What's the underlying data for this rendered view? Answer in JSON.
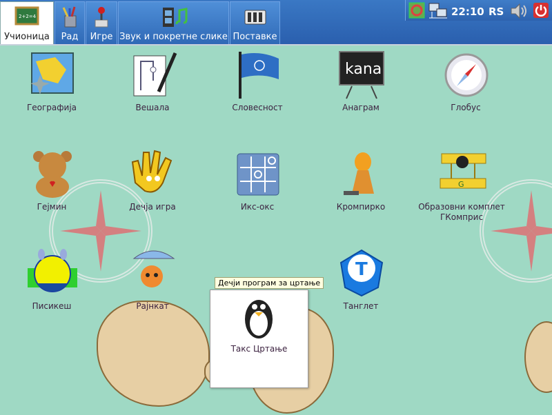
{
  "tabs": [
    {
      "label": "Учионица",
      "icon": "chalkboard-icon",
      "active": true
    },
    {
      "label": "Рад",
      "icon": "pencil-cup-icon",
      "active": false
    },
    {
      "label": "Игре",
      "icon": "joystick-icon",
      "active": false
    },
    {
      "label": "Звук и покретне слике",
      "icon": "film-music-icon",
      "active": false
    },
    {
      "label": "Поставке",
      "icon": "settings-panel-icon",
      "active": false
    }
  ],
  "tray": {
    "clock": "22:10",
    "language": "RS",
    "icons": [
      "safety-ring-icon",
      "network-icon",
      "volume-icon",
      "power-icon"
    ]
  },
  "apps": [
    {
      "label": "Географија",
      "icon": "map-icon"
    },
    {
      "label": "Вешала",
      "icon": "hangman-icon"
    },
    {
      "label": "Словесност",
      "icon": "flag-icon"
    },
    {
      "label": "Анаграм",
      "icon": "blackboard-icon",
      "board_text": "kana"
    },
    {
      "label": "Глобус",
      "icon": "compass-icon"
    },
    {
      "label": "Гејмин",
      "icon": "teddy-bear-icon"
    },
    {
      "label": "Дечја игра",
      "icon": "hand-icon"
    },
    {
      "label": "Икс-окс",
      "icon": "tic-tac-toe-icon"
    },
    {
      "label": "Кромпирко",
      "icon": "potato-icon"
    },
    {
      "label": "Образовни комплет ГКомприс",
      "icon": "airplane-penguin-icon"
    },
    {
      "label": "Писикеш",
      "icon": "pisikesh-icon"
    },
    {
      "label": "Рајнкат",
      "icon": "rain-cat-icon"
    },
    {
      "label": "Такс Цртање",
      "icon": "tux-paint-icon"
    },
    {
      "label": "Танглет",
      "icon": "tanglet-dice-icon",
      "dice_letter": "T"
    }
  ],
  "tooltip": "Дечји програм за цртање",
  "colors": {
    "topbar": "#2a5fae",
    "background": "#9fd9c4",
    "label": "#3c2240"
  }
}
